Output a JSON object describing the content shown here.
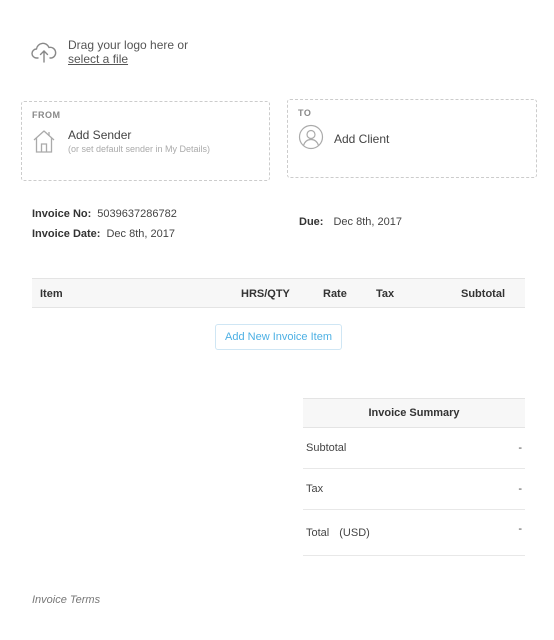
{
  "logo": {
    "prompt": "Drag your logo here or",
    "link": "select a file",
    "icon": "cloud-upload-icon"
  },
  "from": {
    "label": "FROM",
    "title": "Add Sender",
    "subtitle": "(or set default sender in My Details)",
    "icon": "house-icon"
  },
  "to": {
    "label": "TO",
    "title": "Add Client",
    "icon": "user-icon"
  },
  "meta": {
    "invoice_no_label": "Invoice No:",
    "invoice_no": "5039637286782",
    "invoice_date_label": "Invoice Date:",
    "invoice_date": "Dec 8th, 2017",
    "due_label": "Due:",
    "due": "Dec 8th, 2017"
  },
  "items": {
    "columns": [
      "Item",
      "HRS/QTY",
      "Rate",
      "Tax",
      "Subtotal"
    ],
    "add_button": "Add New Invoice Item"
  },
  "summary": {
    "title": "Invoice Summary",
    "subtotal_label": "Subtotal",
    "subtotal_value": "-",
    "tax_label": "Tax",
    "tax_value": "-",
    "total_label": "Total",
    "currency": "(USD)",
    "total_value": "-"
  },
  "terms": {
    "placeholder": "Invoice Terms"
  },
  "colors": {
    "accent": "#4db0e4",
    "border": "#cccccc",
    "header_bg": "#f7f7f7"
  }
}
